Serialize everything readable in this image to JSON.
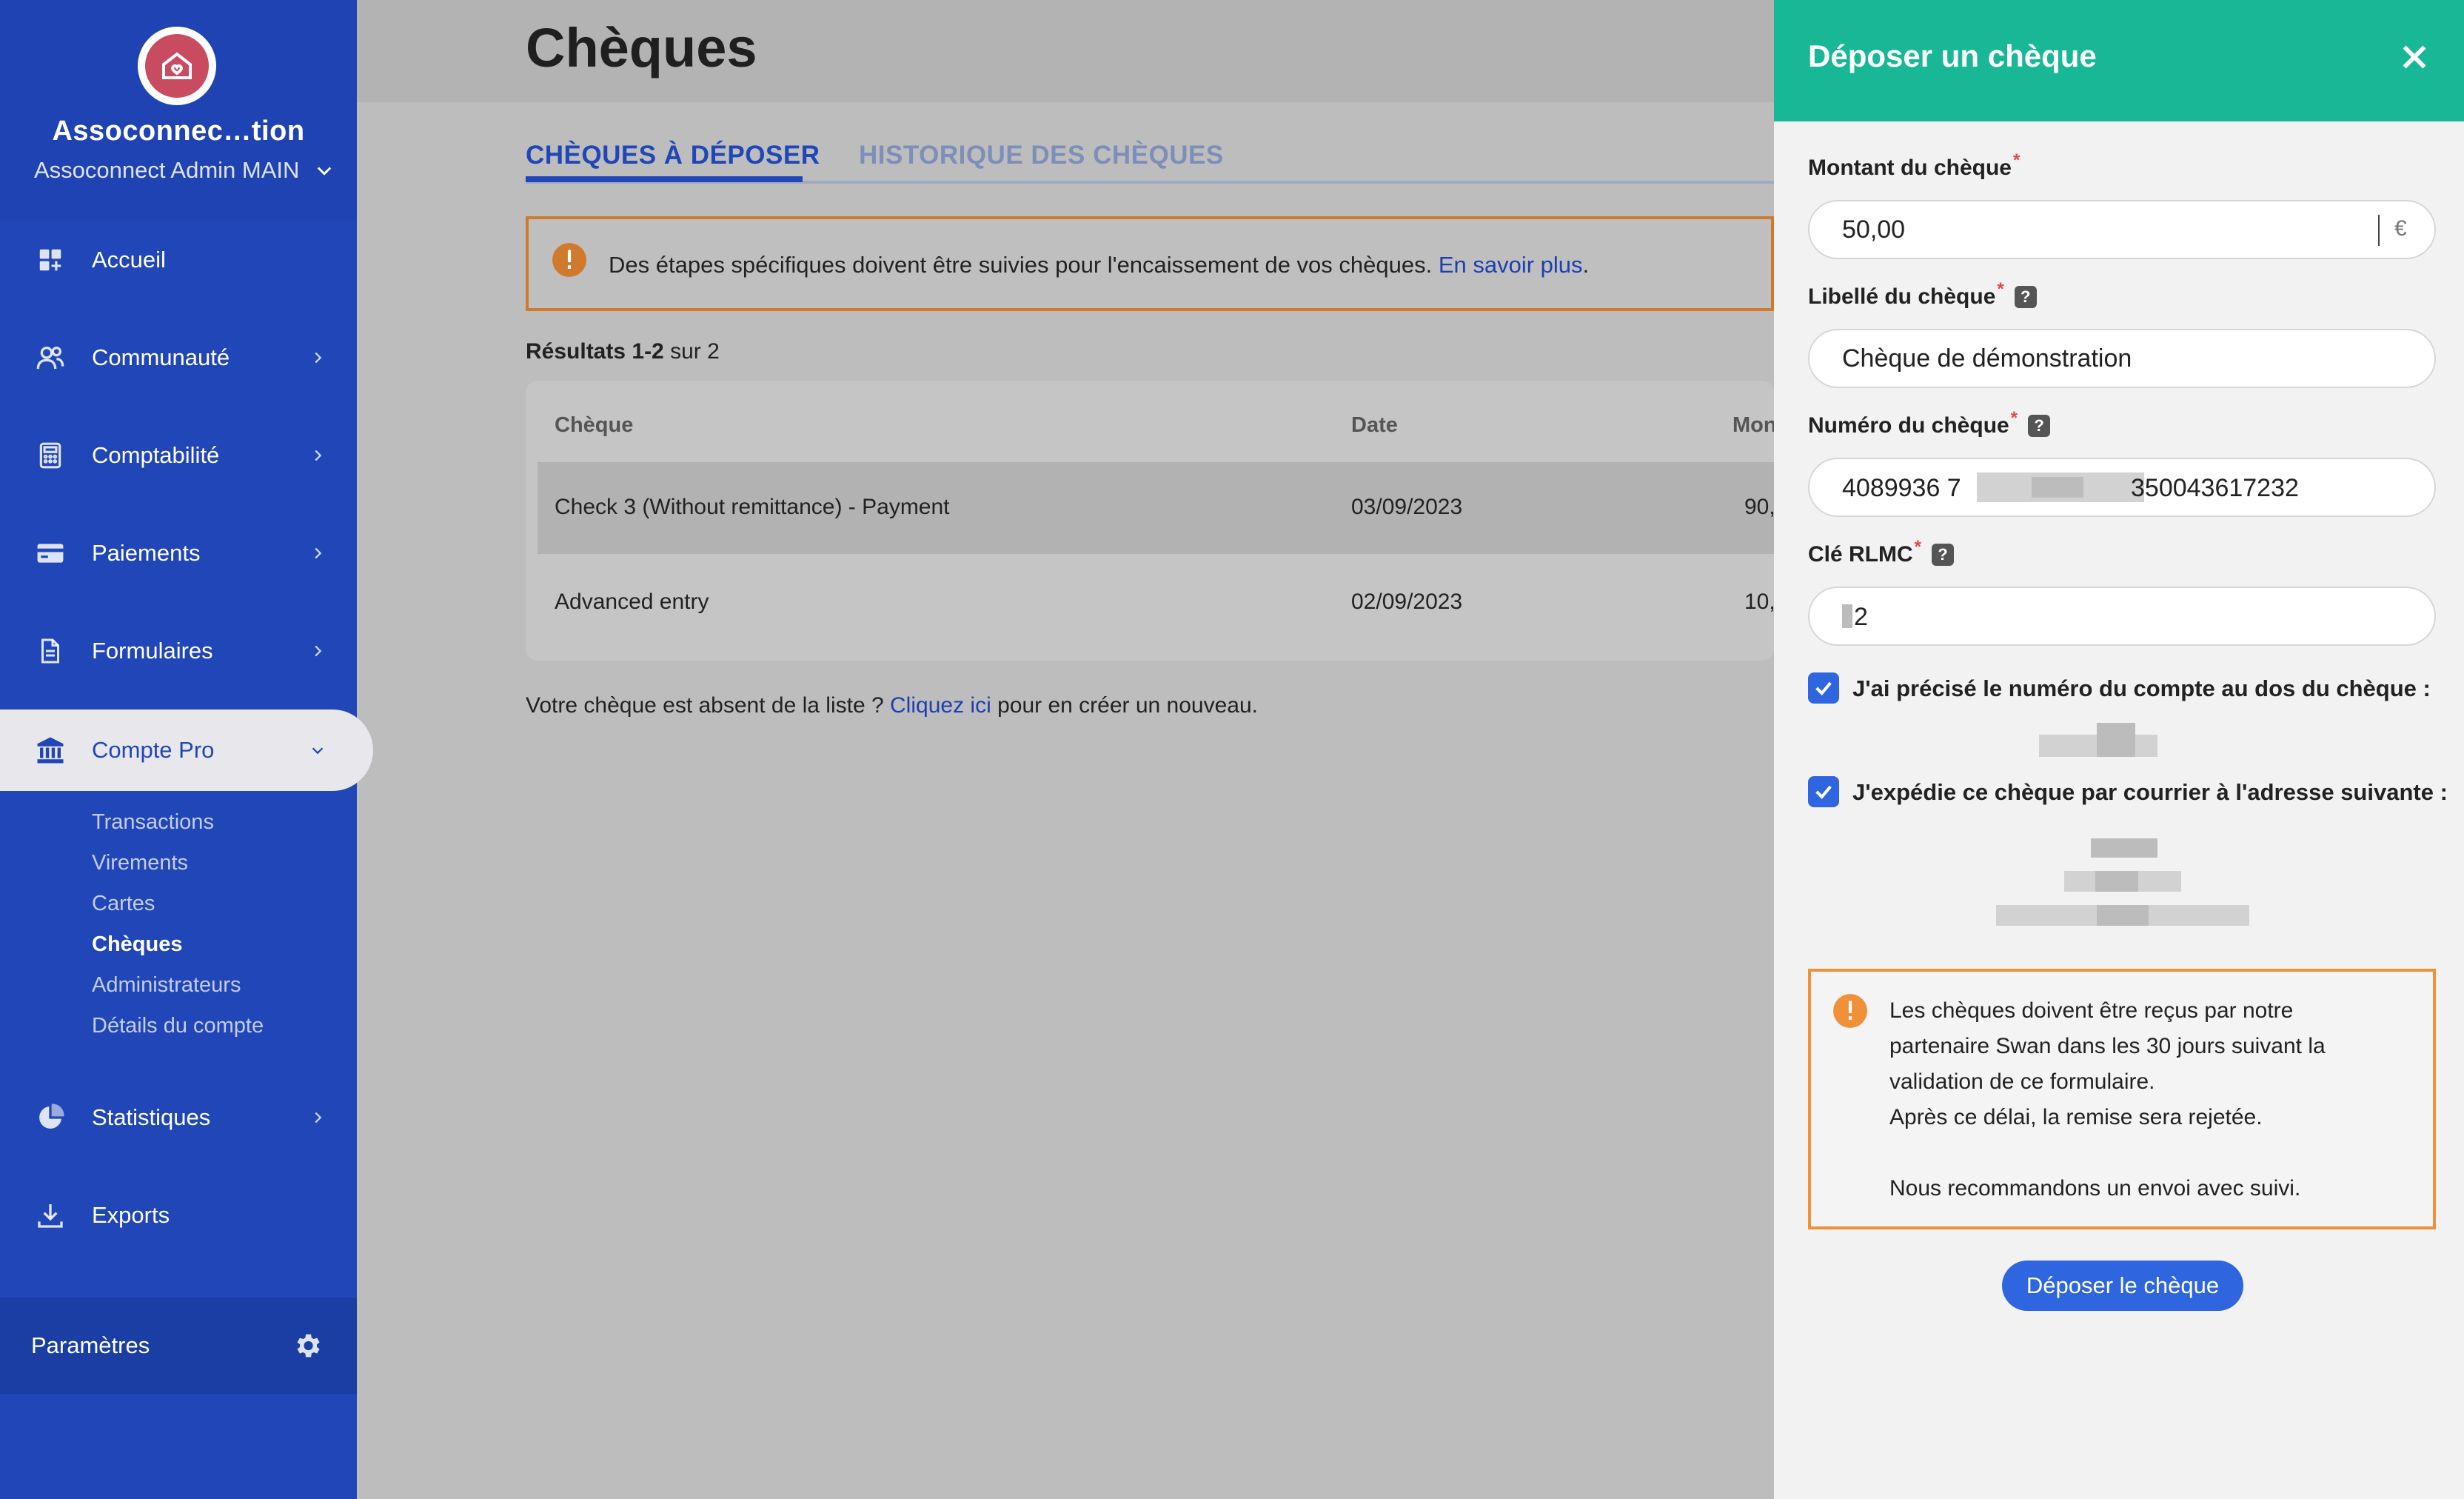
{
  "sidebar": {
    "org_name": "Assoconnec…tion",
    "org_sub": "Assoconnect Admin MAIN",
    "nav": {
      "accueil": "Accueil",
      "communaute": "Communauté",
      "comptabilite": "Comptabilité",
      "paiements": "Paiements",
      "formulaires": "Formulaires",
      "compte_pro": "Compte Pro",
      "statistiques": "Statistiques",
      "exports": "Exports"
    },
    "subnav": {
      "transactions": "Transactions",
      "virements": "Virements",
      "cartes": "Cartes",
      "cheques": "Chèques",
      "administrateurs": "Administrateurs",
      "details": "Détails du compte"
    },
    "params": "Paramètres"
  },
  "main": {
    "title": "Chèques",
    "tabs": [
      "CHÈQUES À DÉPOSER",
      "HISTORIQUE DES CHÈQUES"
    ],
    "alert_text": "Des étapes spécifiques doivent être suivies pour l'encaissement de vos chèques.",
    "alert_link": "En savoir plus",
    "alert_end": ".",
    "results_bold": "Résultats 1-2",
    "results_rest": "sur 2",
    "columns": [
      "Chèque",
      "Date",
      "Mon"
    ],
    "rows": [
      {
        "cheque": "Check 3 (Without remittance) - Payment",
        "date": "03/09/2023",
        "amount": "90,"
      },
      {
        "cheque": "Advanced entry",
        "date": "02/09/2023",
        "amount": "10,"
      }
    ],
    "missing_text": "Votre chèque est absent de la liste ?",
    "missing_link": "Cliquez ici",
    "missing_end": "pour en créer un nouveau."
  },
  "drawer": {
    "title": "Déposer un chèque",
    "amount_label": "Montant du chèque",
    "amount_value": "50,00",
    "currency": "€",
    "libelle_label": "Libellé du chèque",
    "libelle_value": "Chèque de démonstration",
    "numero_label": "Numéro du chèque",
    "numero_start": "4089936 7",
    "numero_end": "350043617232",
    "rlmc_label": "Clé RLMC",
    "rlmc_value": "2",
    "required_mark": "*",
    "help_mark": "?",
    "check1_label": "J'ai précisé le numéro du compte au dos du chèque :",
    "check2_label": "J'expédie ce chèque par courrier à l'adresse suivante :",
    "warning_lines": [
      "Les chèques doivent être reçus par notre",
      "partenaire Swan dans les 30 jours suivant la",
      "validation de ce formulaire.",
      "Après ce délai, la remise sera rejetée.",
      "Nous recommandons un envoi avec suivi."
    ],
    "submit": "Déposer le chèque"
  },
  "colors": {
    "sidebar": "#2146b7",
    "drawer_header": "#18b795",
    "primary": "#2f66e0",
    "warning": "#f0913a"
  }
}
